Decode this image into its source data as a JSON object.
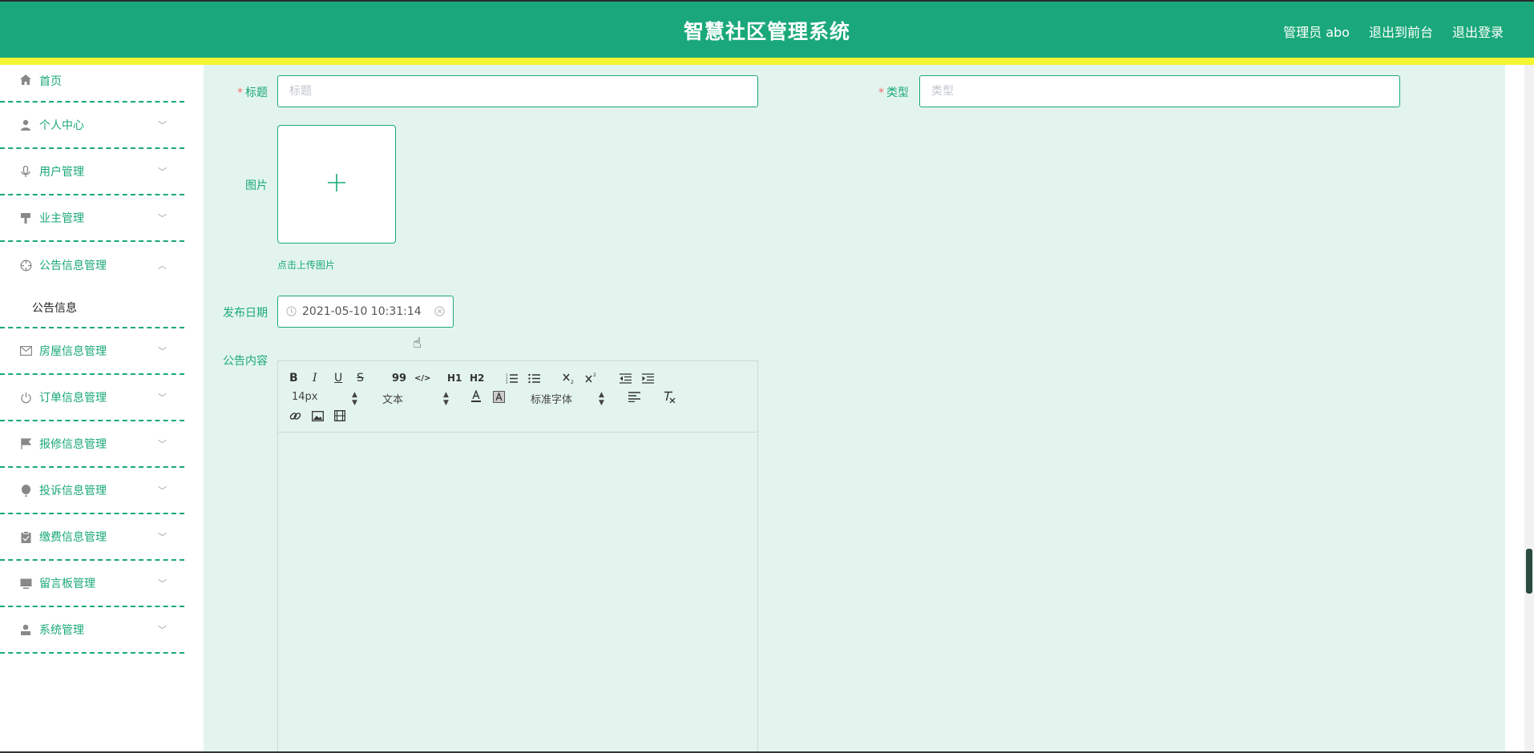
{
  "header": {
    "title": "智慧社区管理系统",
    "admin_label": "管理员 abo",
    "to_frontend": "退出到前台",
    "logout": "退出登录"
  },
  "sidebar": {
    "items": [
      {
        "label": "首页",
        "icon": "home-icon"
      },
      {
        "label": "个人中心",
        "icon": "user-icon"
      },
      {
        "label": "用户管理",
        "icon": "microphone-icon"
      },
      {
        "label": "业主管理",
        "icon": "brush-icon"
      },
      {
        "label": "公告信息管理",
        "icon": "target-icon"
      },
      {
        "label": "房屋信息管理",
        "icon": "message-icon"
      },
      {
        "label": "订单信息管理",
        "icon": "power-icon"
      },
      {
        "label": "报修信息管理",
        "icon": "flag-icon"
      },
      {
        "label": "投诉信息管理",
        "icon": "balloon-icon"
      },
      {
        "label": "缴费信息管理",
        "icon": "clipboard-icon"
      },
      {
        "label": "留言板管理",
        "icon": "monitor-icon"
      },
      {
        "label": "系统管理",
        "icon": "user-solid-icon"
      }
    ],
    "sub_item": "公告信息"
  },
  "form": {
    "title_label": "标题",
    "title_placeholder": "标题",
    "type_label": "类型",
    "type_placeholder": "类型",
    "image_label": "图片",
    "upload_hint": "点击上传图片",
    "date_label": "发布日期",
    "date_value": "2021-05-10 10:31:14",
    "content_label": "公告内容"
  },
  "editor": {
    "font_size": "14px",
    "header_select": "文本",
    "font_family": "标准字体",
    "buttons": [
      "B",
      "I",
      "U",
      "S",
      "99",
      "</>",
      "H1",
      "H2"
    ]
  },
  "colors": {
    "primary": "#1aa87a",
    "accent_bar": "#f5f532",
    "content_bg": "#e3f4ee"
  }
}
